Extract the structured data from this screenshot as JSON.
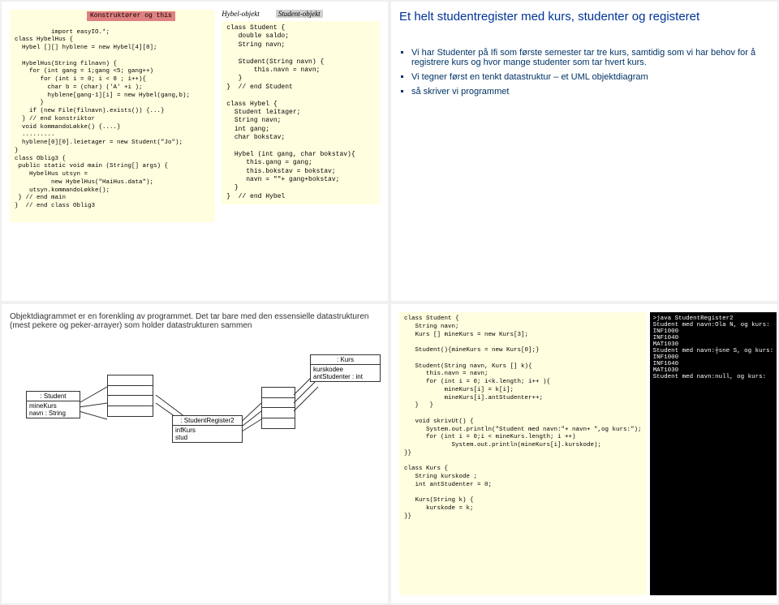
{
  "slide1": {
    "header_tag": "Konstruktører og this",
    "label_hybel": "Hybel-objekt",
    "label_student": "Student-objekt",
    "code_left": "import easyIO.*;\nclass HybelHus {\n  Hybel [][] hyblene = new Hybel[4][8];\n\n  HybelHus(String filnavn) {\n    for (int gang = 1;gang <5; gang++)\n       for (int i = 0; i < 8 ; i++){\n         char b = (char) ('A' +i );\n         hyblene[gang-1][i] = new Hybel(gang,b);\n       }\n    if (new File(filnavn).exists()) {...}\n  } // end konstriktor\n  void kommandoLøkke() {....}\n  .........\n  hyblene[0][0].leietager = new Student(\"Jo\");\n}\nclass Oblig3 {\n public static void main (String[] args) {\n    HybelHus utsyn =\n          new HybelHus(\"HaiHus.data\");\n    utsyn.kommandoLøkke();\n } // end main\n}  // end class Oblig3",
    "code_right": "class Student {\n   double saldo;\n   String navn;\n\n   Student(String navn) {\n       this.navn = navn;\n   }\n}  // end Student\n\nclass Hybel {\n  Student leitager;\n  String navn;\n  int gang;\n  char bokstav;\n\n  Hybel (int gang, char bokstav){\n     this.gang = gang;\n     this.bokstav = bokstav;\n     navn = \"\"+ gang+bokstav;\n  }\n}  // end Hybel"
  },
  "slide2": {
    "title": "Et helt studentregister med kurs, studenter og registeret",
    "bullets": [
      "Vi har Studenter på Ifi som første semester tar tre kurs, samtidig som vi har behov for å registrere kurs og hvor mange studenter som tar hvert kurs.",
      "Vi tegner først en tenkt datastruktur – et UML objektdiagram",
      "så skriver vi programmet"
    ]
  },
  "slide3": {
    "text": "Objektdiagrammet er en forenkling av programmet. Det tar bare med den essensielle datastrukturen (mest pekere og peker-arrayer) som holder datastrukturen sammen",
    "uml_student_title": ": Student",
    "uml_student_body": "mineKurs\nnavn : String",
    "uml_reg_title": ": StudentRegister2",
    "uml_reg_body": "infKurs\nstud",
    "uml_kurs_title": ": Kurs",
    "uml_kurs_body": "kurskodee\nantStudenter : int"
  },
  "slide4": {
    "code": "class Student {\n   String navn;\n   Kurs [] mineKurs = new Kurs[3];\n\n   Student(){mineKurs = new Kurs[0];}\n\n   Student(String navn, Kurs [] k){\n      this.navn = navn;\n      for (int i = 0; i<k.length; i++ ){\n           mineKurs[i] = k[i];\n           mineKurs[i].antStudenter++;\n   }   }\n\n   void skrivUt() {\n      System.out.println(\"Student med navn:\"+ navn+ \",og kurs:\");\n      for (int i = 0;i < mineKurs.length; i ++)\n             System.out.println(mineKurs[i].kurskode);\n}}\n\nclass Kurs {\n   String kurskode ;\n   int antStudenter = 0;\n\n   Kurs(String k) {\n      kurskode = k;\n}}",
    "output": ">java StudentRegister2\nStudent med navn:Ola N, og kurs:\nINF1000\nINF1040\nMAT1030\nStudent med navn:┼sne S, og kurs:\nINF1000\nINF1040\nMAT1030\nStudent med navn:null, og kurs:"
  }
}
